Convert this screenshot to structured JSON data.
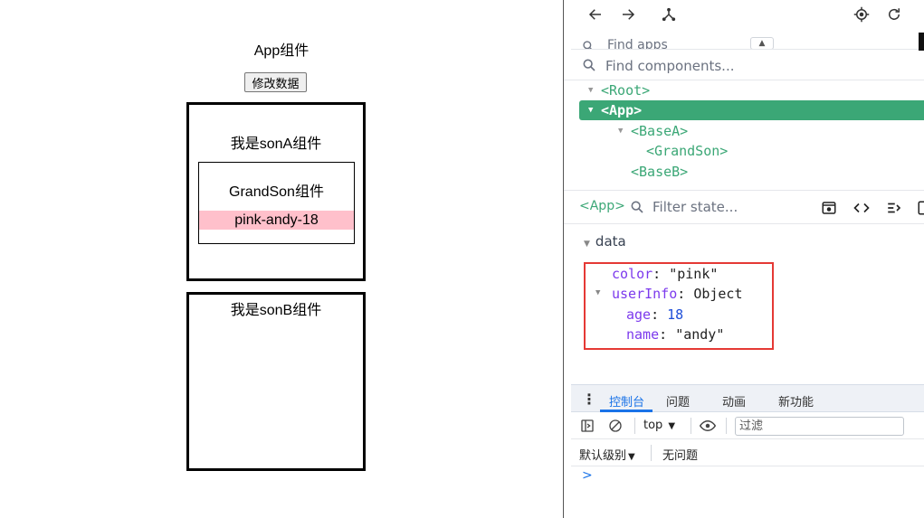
{
  "app": {
    "title": "App组件",
    "modify_button": "修改数据",
    "son_a": {
      "title": "我是sonA组件",
      "grandson": {
        "title": "GrandSon组件",
        "info": "pink-andy-18"
      }
    },
    "son_b": {
      "title": "我是sonB组件"
    }
  },
  "devtools": {
    "find_apps_placeholder": "Find apps",
    "find_components_placeholder": "Find components...",
    "tree": [
      {
        "label": "<Root>",
        "expanded": true
      },
      {
        "label": "<App>",
        "expanded": true,
        "selected": true
      },
      {
        "label": "<BaseA>",
        "expanded": true
      },
      {
        "label": "<GrandSon>"
      },
      {
        "label": "<BaseB>"
      }
    ],
    "state": {
      "selected_tag": "<App>",
      "filter_placeholder": "Filter state...",
      "section": "data",
      "props": {
        "color_key": "color",
        "color_value": "\"pink\"",
        "userinfo_key": "userInfo",
        "userinfo_value": "Object",
        "age_key": "age",
        "age_value": "18",
        "name_key": "name",
        "name_value": "\"andy\""
      }
    },
    "console": {
      "tabs": [
        "控制台",
        "问题",
        "动画",
        "新功能"
      ],
      "context": "top",
      "filter_placeholder": "过滤",
      "level": "默认级别",
      "issues": "无问题",
      "prompt": ">"
    }
  },
  "colors": {
    "vue_green": "#3ba776",
    "highlight_box": "#e53935",
    "grandson_bg": "#ffc0cb",
    "active_tab": "#1a73e8"
  }
}
